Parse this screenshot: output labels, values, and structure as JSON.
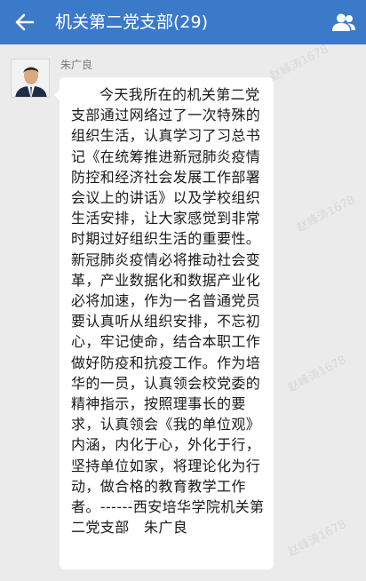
{
  "header": {
    "title": "机关第二党支部(29)",
    "bg_color": "#3b79c9",
    "back_icon": "arrow-left-icon",
    "members_icon": "group-members-icon"
  },
  "message": {
    "sender_name": "朱广良",
    "avatar": "person-in-suit-avatar",
    "text": "今天我所在的机关第二党支部通过网络过了一次特殊的组织生活，认真学习了习总书记《在统筹推进新冠肺炎疫情防控和经济社会发展工作部署会议上的讲话》以及学校组织生活安排，让大家感觉到非常时期过好组织生活的重要性。新冠肺炎疫情必将推动社会变革，产业数据化和数据产业化必将加速，作为一名普通党员要认真听从组织安排，不忘初心，牢记使命，结合本职工作做好防疫和抗疫工作。作为培华的一员，认真领会校党委的精神指示，按照理事长的要求，认真领会《我的单位观》内涵，内化于心，外化于行，坚持单位如家，将理论化为行动，做合格的教育教学工作者。------西安培华学院机关第二党支部　朱广良"
  },
  "watermark": {
    "text": "赵峰涛1678"
  }
}
